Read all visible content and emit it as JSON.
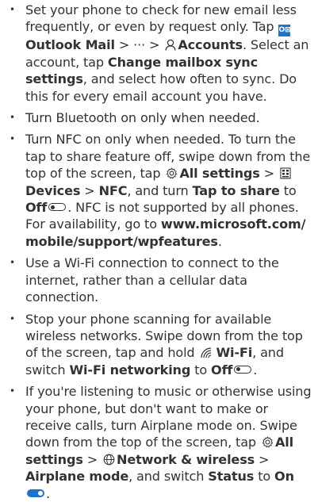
{
  "icons": {
    "outlook_badge": "O⊠",
    "more": "···",
    "gear": "settings-gear",
    "person": "accounts-person",
    "devices": "devices",
    "wifi": "wifi",
    "globe": "network-globe",
    "toggle_off": "toggle-off",
    "toggle_on": "toggle-on"
  },
  "colors": {
    "text": "#333333",
    "accent": "#1f72c9"
  },
  "tips": [
    {
      "t1": "Set your phone to check for new email less frequently, or even by request only. Tap ",
      "b1": "Outlook Mail",
      "t2": " > ",
      "t3": " > ",
      "b2": "Accounts",
      "t4": ". Select an account, tap ",
      "b3": "Change mailbox sync settings",
      "t5": ", and select how often to sync. Do this for every email account you have."
    },
    {
      "t1": "Turn Bluetooth on only when needed."
    },
    {
      "t1": "Turn NFC on only when needed. To turn the tap to share feature off, swipe down from the top of the screen, tap ",
      "b1": "All settings",
      "t2": " > ",
      "b2": "Devices",
      "t3": " > ",
      "b3": "NFC",
      "t4": ", and turn ",
      "b4": "Tap to share",
      "t5": " to ",
      "b5": "Off",
      "t6": ". NFC is not supported by all phones. For availability, go to ",
      "b6": "www.microsoft.com/ mobile/support/wpfeatures",
      "t7": "."
    },
    {
      "t1": "Use a Wi-Fi connection to connect to the internet, rather than a cellular data connection."
    },
    {
      "t1": "Stop your phone scanning for available wireless networks. Swipe down from the top of the screen, tap and hold ",
      "b1": "Wi-Fi",
      "t2": ", and switch ",
      "b2": "Wi-Fi networking",
      "t3": " to ",
      "b3": "Off",
      "t4": "."
    },
    {
      "t1": "If you're listening to music or otherwise using your phone, but don't want to make or receive calls, turn Airplane mode on. Swipe down from the top of the screen, tap ",
      "b1": "All settings",
      "t2": " > ",
      "b2": "Network & wireless",
      "t3": " > ",
      "b3": "Airplane mode",
      "t4": ", and switch ",
      "b4": "Status",
      "t5": " to ",
      "b5": "On",
      "t6": "."
    }
  ]
}
